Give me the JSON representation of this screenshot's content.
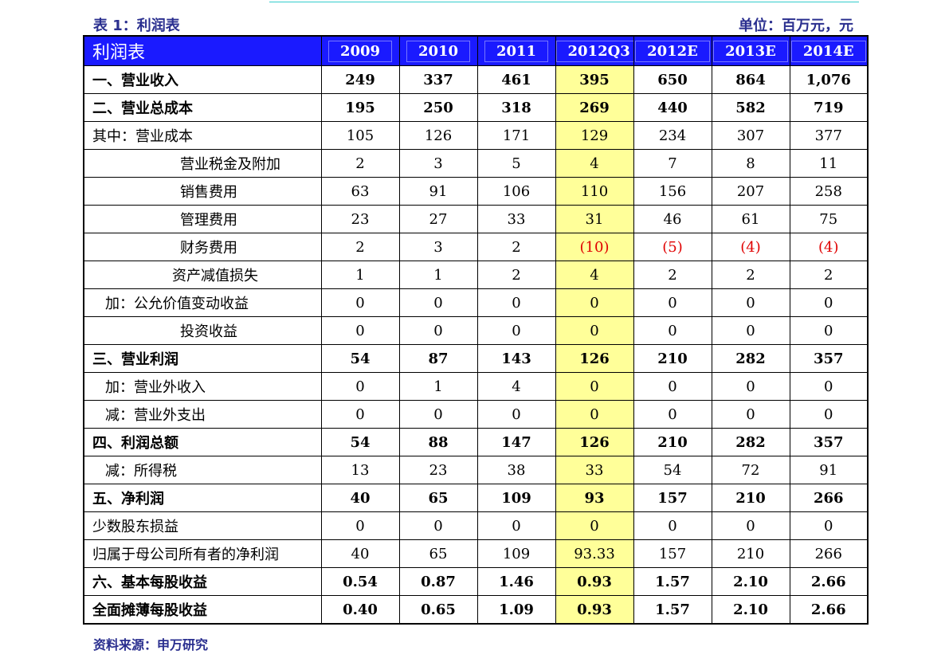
{
  "caption_left": "表 1：利润表",
  "caption_right": "单位：百万元，元",
  "source": "资料来源：申万研究",
  "table": {
    "title": "利润表",
    "columns": [
      "2009",
      "2010",
      "2011",
      "2012Q3",
      "2012E",
      "2013E",
      "2014E"
    ],
    "highlight_column": "2012Q3",
    "rows": [
      {
        "label": "一、营业收入",
        "bold": true,
        "indent": 0,
        "values": [
          "249",
          "337",
          "461",
          "395",
          "650",
          "864",
          "1,076"
        ]
      },
      {
        "label": "二、营业总成本",
        "bold": true,
        "indent": 0,
        "values": [
          "195",
          "250",
          "318",
          "269",
          "440",
          "582",
          "719"
        ]
      },
      {
        "label": "其中：营业成本",
        "bold": false,
        "indent": 0,
        "values": [
          "105",
          "126",
          "171",
          "129",
          "234",
          "307",
          "377"
        ]
      },
      {
        "label": "营业税金及附加",
        "bold": false,
        "indent": 3,
        "values": [
          "2",
          "3",
          "5",
          "4",
          "7",
          "8",
          "11"
        ]
      },
      {
        "label": "销售费用",
        "bold": false,
        "indent": 3,
        "values": [
          "63",
          "91",
          "106",
          "110",
          "156",
          "207",
          "258"
        ]
      },
      {
        "label": "管理费用",
        "bold": false,
        "indent": 3,
        "values": [
          "23",
          "27",
          "33",
          "31",
          "46",
          "61",
          "75"
        ]
      },
      {
        "label": "财务费用",
        "bold": false,
        "indent": 3,
        "values": [
          "2",
          "3",
          "2",
          "(10)",
          "(5)",
          "(4)",
          "(4)"
        ]
      },
      {
        "label": "资产减值损失",
        "bold": false,
        "indent": 2,
        "values": [
          "1",
          "1",
          "2",
          "4",
          "2",
          "2",
          "2"
        ]
      },
      {
        "label": "加：公允价值变动收益",
        "bold": false,
        "indent": 1,
        "values": [
          "0",
          "0",
          "0",
          "0",
          "0",
          "0",
          "0"
        ]
      },
      {
        "label": "投资收益",
        "bold": false,
        "indent": 3,
        "values": [
          "0",
          "0",
          "0",
          "0",
          "0",
          "0",
          "0"
        ]
      },
      {
        "label": "三、营业利润",
        "bold": true,
        "indent": 0,
        "values": [
          "54",
          "87",
          "143",
          "126",
          "210",
          "282",
          "357"
        ]
      },
      {
        "label": "加：营业外收入",
        "bold": false,
        "indent": 1,
        "values": [
          "0",
          "1",
          "4",
          "0",
          "0",
          "0",
          "0"
        ]
      },
      {
        "label": "减：营业外支出",
        "bold": false,
        "indent": 1,
        "values": [
          "0",
          "0",
          "0",
          "0",
          "0",
          "0",
          "0"
        ]
      },
      {
        "label": "四、利润总额",
        "bold": true,
        "indent": 0,
        "values": [
          "54",
          "88",
          "147",
          "126",
          "210",
          "282",
          "357"
        ]
      },
      {
        "label": "减：所得税",
        "bold": false,
        "indent": 1,
        "values": [
          "13",
          "23",
          "38",
          "33",
          "54",
          "72",
          "91"
        ]
      },
      {
        "label": "五、净利润",
        "bold": true,
        "indent": 0,
        "values": [
          "40",
          "65",
          "109",
          "93",
          "157",
          "210",
          "266"
        ]
      },
      {
        "label": "少数股东损益",
        "bold": false,
        "indent": 0,
        "values": [
          "0",
          "0",
          "0",
          "0",
          "0",
          "0",
          "0"
        ]
      },
      {
        "label": "归属于母公司所有者的净利润",
        "bold": false,
        "indent": 0,
        "values": [
          "40",
          "65",
          "109",
          "93.33",
          "157",
          "210",
          "266"
        ]
      },
      {
        "label": "六、基本每股收益",
        "bold": true,
        "indent": 0,
        "values": [
          "0.54",
          "0.87",
          "1.46",
          "0.93",
          "1.57",
          "2.10",
          "2.66"
        ]
      },
      {
        "label": "全面摊薄每股收益",
        "bold": true,
        "indent": 0,
        "values": [
          "0.40",
          "0.65",
          "1.09",
          "0.93",
          "1.57",
          "2.10",
          "2.66"
        ]
      }
    ]
  },
  "colors": {
    "header_bg": "#1a1aff",
    "highlight_bg": "#ffff99",
    "negative": "#e00000",
    "caption": "#2a2f8f"
  }
}
